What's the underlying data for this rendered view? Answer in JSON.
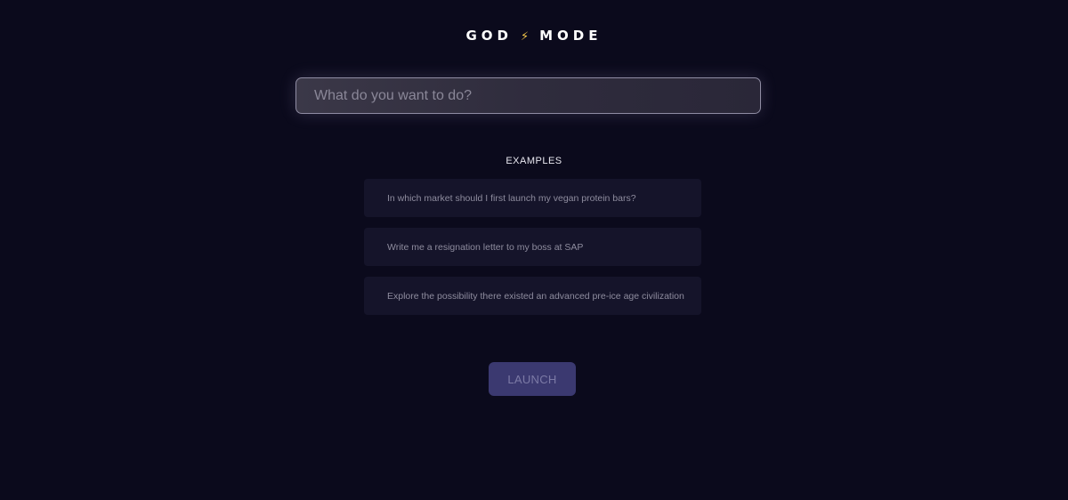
{
  "header": {
    "title_left": "GOD",
    "bolt_icon": "⚡",
    "title_right": "MODE"
  },
  "search": {
    "placeholder": "What do you want to do?",
    "value": ""
  },
  "examples": {
    "title": "EXAMPLES",
    "items": [
      "In which market should I first launch my vegan protein bars?",
      "Write me a resignation letter to my boss at SAP",
      "Explore the possibility there existed an advanced pre-ice age civilization"
    ]
  },
  "actions": {
    "launch_label": "LAUNCH"
  },
  "colors": {
    "background": "#0b0a1c",
    "bolt": "#f5c84a",
    "card": "#15142a",
    "launch_button": "#3b3970"
  }
}
